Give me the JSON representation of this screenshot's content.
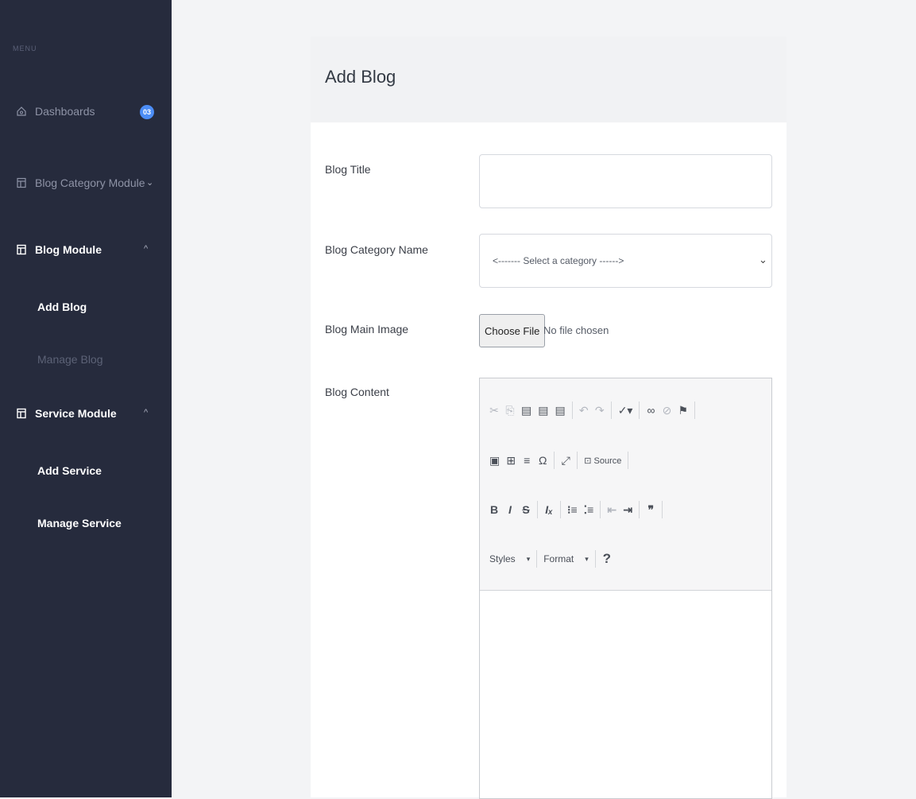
{
  "sidebar": {
    "menu_label": "MENU",
    "dashboards": {
      "label": "Dashboards",
      "badge": "03"
    },
    "blog_category_module": {
      "label": "Blog Category Module"
    },
    "blog_module": {
      "label": "Blog Module",
      "children": [
        "Add Blog",
        "Manage Blog"
      ]
    },
    "service_module": {
      "label": "Service Module",
      "children": [
        "Add Service",
        "Manage Service"
      ]
    }
  },
  "form": {
    "title": "Add Blog",
    "blog_title_label": "Blog Title",
    "blog_title_value": "",
    "category_label": "Blog Category Name",
    "category_selected": "<------- Select a category ------>",
    "main_image_label": "Blog Main Image",
    "choose_file_label": "Choose File",
    "file_status": "No file chosen",
    "content_label": "Blog Content"
  },
  "editor": {
    "source_label": "Source",
    "styles_label": "Styles",
    "format_label": "Format",
    "help_glyph": "?"
  },
  "colors": {
    "sidebar_bg": "#262b3d",
    "badge": "#4c8df6"
  }
}
